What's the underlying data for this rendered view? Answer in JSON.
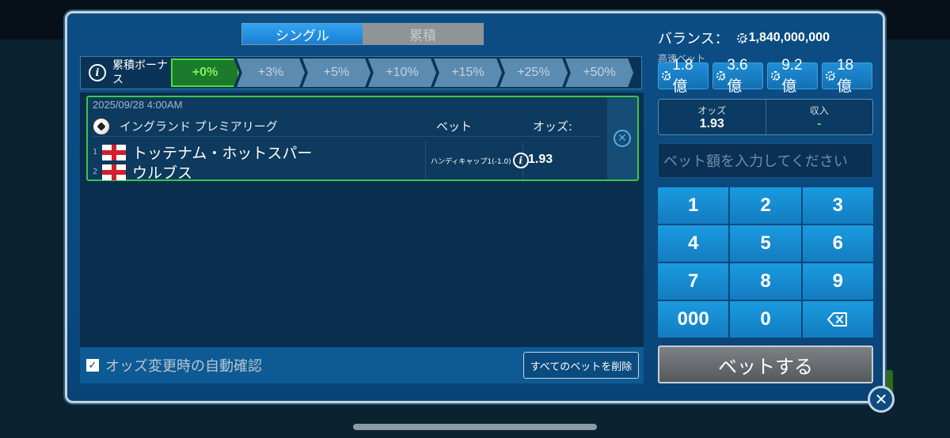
{
  "tabs": {
    "single": "シングル",
    "parlay": "累積"
  },
  "bonus": {
    "label": "累積ボーナス",
    "steps": [
      "+0%",
      "+3%",
      "+5%",
      "+10%",
      "+15%",
      "+25%",
      "+50%"
    ],
    "active_index": 0
  },
  "bet": {
    "date": "2025/09/28 4:00AM",
    "league": "イングランド プレミアリーグ",
    "col_bet": "ベット",
    "col_odds": "オッズ:",
    "teams": [
      {
        "num": "1",
        "name": "トッテナム・ホットスパー"
      },
      {
        "num": "2",
        "name": "ウルブス"
      }
    ],
    "handicap": "ハンディキャップ1(-1.0)",
    "odds": "1.93"
  },
  "footer": {
    "auto_confirm": "オッズ変更時の自動確認",
    "auto_confirm_checked": true,
    "delete_all": "すべてのベットを削除"
  },
  "right": {
    "balance_label": "バランス：",
    "balance_amount": "1,840,000,000",
    "quick_label": "高速ベット",
    "quick_bets": [
      "1.8億",
      "3.6億",
      "9.2億",
      "18億"
    ],
    "odds_label": "オッズ",
    "odds_value": "1.93",
    "income_label": "収入",
    "income_value": "-",
    "amount_placeholder": "ベット額を入力してください",
    "keys": [
      "1",
      "2",
      "3",
      "4",
      "5",
      "6",
      "7",
      "8",
      "9",
      "000",
      "0"
    ],
    "bet_button": "ベットする"
  },
  "colors": {
    "modal_bg": "#0c4d84",
    "active_tab": "#1b7ed0",
    "bonus_active": "#47e03a",
    "keypad": "#1a9be0",
    "bet_button": "#6b7075"
  }
}
